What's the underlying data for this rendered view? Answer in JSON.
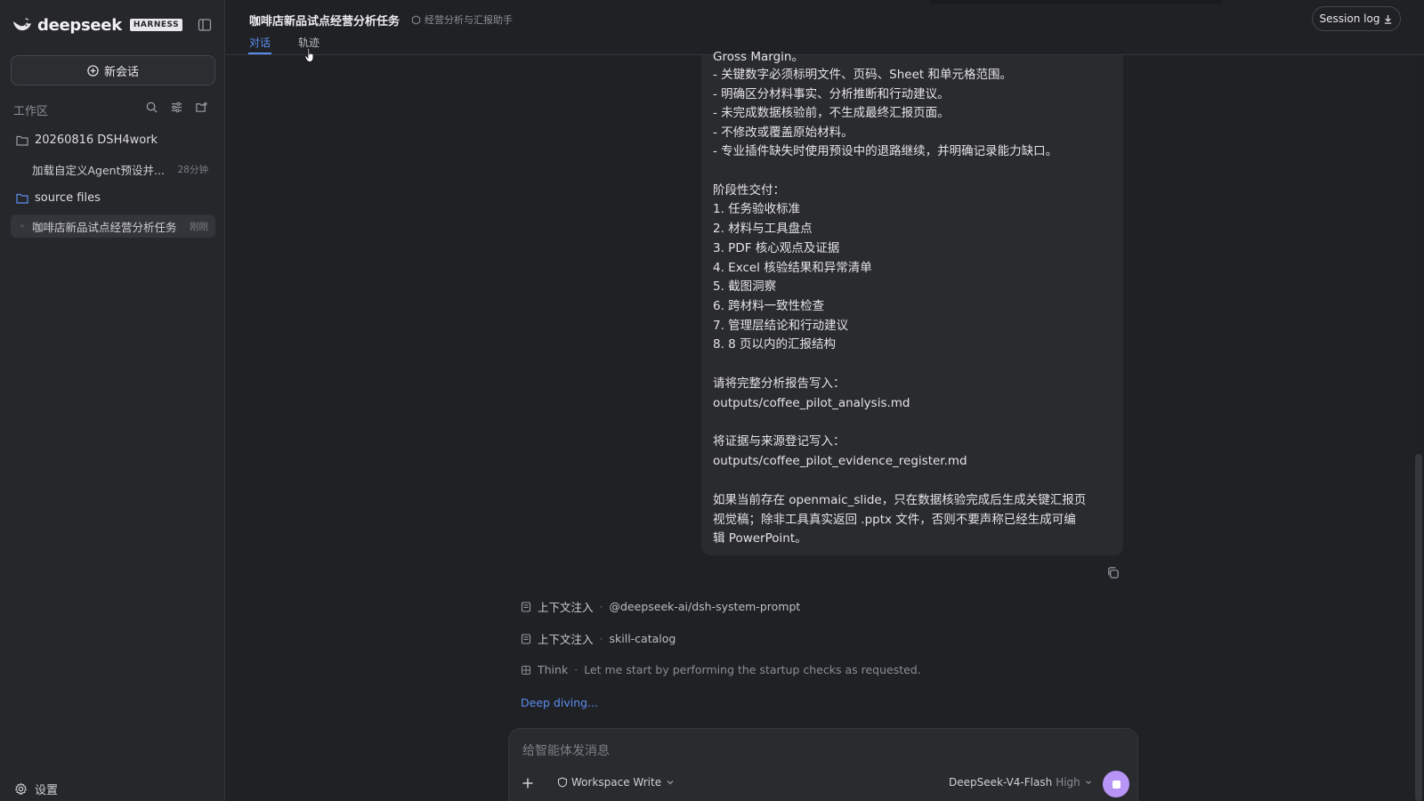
{
  "brand": {
    "name": "deepseek",
    "badge": "HARNESS"
  },
  "sidebar": {
    "new_chat_label": "新会话",
    "workspace_label": "工作区",
    "folders": [
      {
        "name": "20260816 DSH4work"
      },
      {
        "name": "source files"
      }
    ],
    "sessions": [
      {
        "title": "加载自定义Agent预设并...",
        "time": "28分钟"
      },
      {
        "title": "咖啡店新品试点经营分析任务",
        "time": "刚刚"
      }
    ],
    "settings_label": "设置"
  },
  "header": {
    "title": "咖啡店新品试点经营分析任务",
    "agent": "经营分析与汇报助手",
    "tabs": [
      "对话",
      "轨迹"
    ],
    "session_log": "Session log"
  },
  "message": {
    "lines": [
      "Gross Margin。",
      "- 关键数字必须标明文件、页码、Sheet 和单元格范围。",
      "- 明确区分材料事实、分析推断和行动建议。",
      "- 未完成数据核验前，不生成最终汇报页面。",
      "- 不修改或覆盖原始材料。",
      "- 专业插件缺失时使用预设中的退路继续，并明确记录能力缺口。",
      "阶段性交付：",
      "1. 任务验收标准",
      "2. 材料与工具盘点",
      "3. PDF 核心观点及证据",
      "4. Excel 核验结果和异常清单",
      "5. 截图洞察",
      "6. 跨材料一致性检查",
      "7. 管理层结论和行动建议",
      "8. 8 页以内的汇报结构",
      "请将完整分析报告写入：",
      "outputs/coffee_pilot_analysis.md",
      "将证据与来源登记写入：",
      "outputs/coffee_pilot_evidence_register.md",
      "如果当前存在 openmaic_slide，只在数据核验完成后生成关键汇报页",
      "视觉稿；除非工具真实返回 .pptx 文件，否则不要声称已经生成可编",
      "辑 PowerPoint。"
    ]
  },
  "context": [
    {
      "label": "上下文注入",
      "value": "@deepseek-ai/dsh-system-prompt"
    },
    {
      "label": "上下文注入",
      "value": "skill-catalog"
    }
  ],
  "think": {
    "label": "Think",
    "text": "Let me start by performing the startup checks as requested."
  },
  "status": "Deep diving...",
  "composer": {
    "placeholder": "给智能体发消息",
    "mode": "Workspace Write",
    "model": "DeepSeek-V4-Flash",
    "level": "High"
  },
  "colors": {
    "accent": "#5b8def",
    "stop_button": "#b794f6",
    "background": "#202125",
    "sidebar": "#26272b"
  }
}
